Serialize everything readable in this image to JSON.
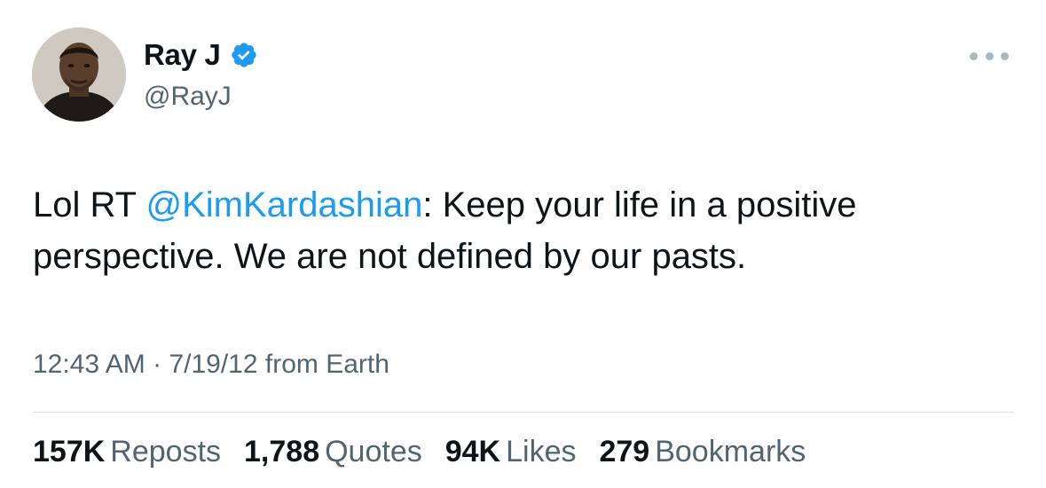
{
  "author": {
    "display_name": "Ray J",
    "handle": "@RayJ",
    "verified_icon": "verified-badge-icon",
    "verified_color": "#1d9bf0"
  },
  "tweet": {
    "text_prefix": "Lol RT ",
    "mention": "@KimKardashian",
    "text_body": ": Keep your life in a positive perspective. We are not defined by our pasts."
  },
  "meta": {
    "time": "12:43 AM",
    "separator": " · ",
    "date": "7/19/12",
    "source": " from Earth"
  },
  "stats": [
    {
      "count": "157K",
      "label": "Reposts"
    },
    {
      "count": "1,788",
      "label": "Quotes"
    },
    {
      "count": "94K",
      "label": "Likes"
    },
    {
      "count": "279",
      "label": "Bookmarks"
    }
  ],
  "colors": {
    "link": "#1d9bf0",
    "secondary_text": "#536471",
    "primary_text": "#0f1419"
  },
  "icons": {
    "more": "more-options-icon",
    "avatar": "profile-avatar"
  }
}
